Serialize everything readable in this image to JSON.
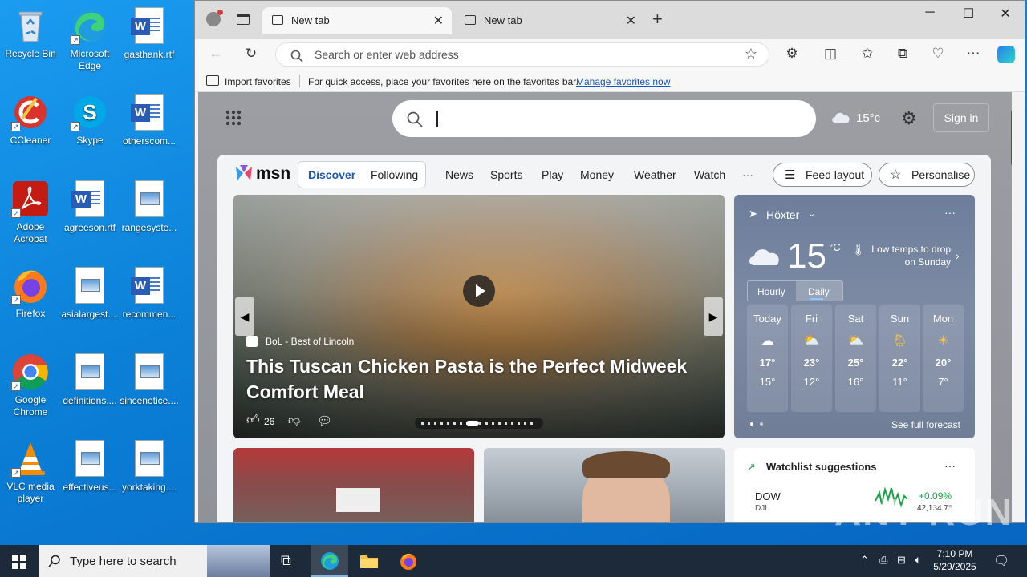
{
  "desktop": {
    "icons": [
      {
        "label": "Recycle Bin"
      },
      {
        "label": "Microsoft Edge"
      },
      {
        "label": "gasthank.rtf"
      },
      {
        "label": "CCleaner"
      },
      {
        "label": "Skype"
      },
      {
        "label": "otherscom..."
      },
      {
        "label": "Adobe Acrobat"
      },
      {
        "label": "agreeson.rtf"
      },
      {
        "label": "rangesyste..."
      },
      {
        "label": "Firefox"
      },
      {
        "label": "asialargest...."
      },
      {
        "label": "recommen..."
      },
      {
        "label": "Google Chrome"
      },
      {
        "label": "definitions...."
      },
      {
        "label": "sincenotice...."
      },
      {
        "label": "VLC media player"
      },
      {
        "label": "effectiveus..."
      },
      {
        "label": "yorktaking...."
      }
    ]
  },
  "browser": {
    "tabs": [
      {
        "label": "New tab"
      },
      {
        "label": "New tab"
      }
    ],
    "address_placeholder": "Search or enter web address",
    "favbar": {
      "import": "Import favorites",
      "message": "For quick access, place your favorites here on the favorites bar.",
      "manage": "Manage favorites now"
    }
  },
  "page": {
    "temp": "15°c",
    "signin": "Sign in",
    "msn_logo": "msn",
    "nav_tabs": [
      "Discover",
      "Following"
    ],
    "nav_links": [
      "News",
      "Sports",
      "Play",
      "Money",
      "Weather",
      "Watch"
    ],
    "more": "···",
    "feed_layout": "Feed layout",
    "personalise": "Personalise",
    "hero": {
      "source": "BoL - Best of Lincoln",
      "title_line1": "This Tuscan Chicken Pasta is the Perfect Midweek",
      "title_line2": "Comfort Meal",
      "likes": "26"
    },
    "weather": {
      "location": "Höxter",
      "temp": "15",
      "unit": "°C",
      "alert_line1": "Low temps to drop",
      "alert_line2": "on Sunday",
      "toggle": [
        "Hourly",
        "Daily"
      ],
      "days": [
        {
          "name": "Today",
          "high": "17°",
          "low": "15°"
        },
        {
          "name": "Fri",
          "high": "23°",
          "low": "12°"
        },
        {
          "name": "Sat",
          "high": "25°",
          "low": "16°"
        },
        {
          "name": "Sun",
          "high": "22°",
          "low": "11°"
        },
        {
          "name": "Mon",
          "high": "20°",
          "low": "7°"
        }
      ],
      "forecast_link": "See full forecast"
    },
    "watchlist": {
      "title": "Watchlist suggestions",
      "symbol": "DOW",
      "sub": "DJI",
      "change": "+0.09%",
      "value": "42,134.75"
    }
  },
  "taskbar": {
    "search_placeholder": "Type here to search",
    "time": "7:10 PM",
    "date": "5/29/2025"
  },
  "watermark": "ANY RUN"
}
